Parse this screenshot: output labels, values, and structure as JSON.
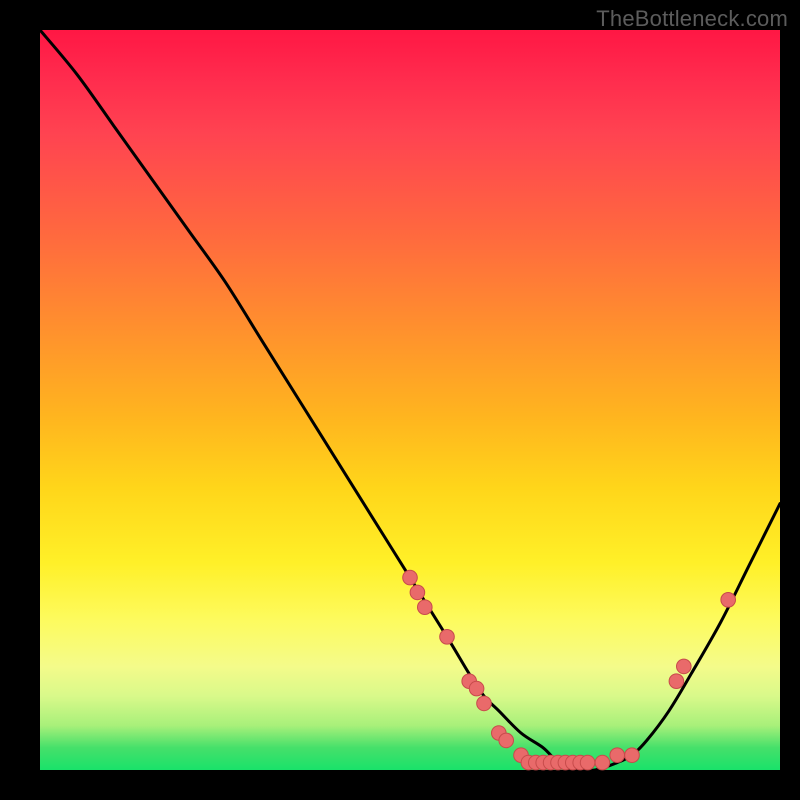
{
  "watermark": "TheBottleneck.com",
  "chart_data": {
    "type": "line",
    "title": "",
    "xlabel": "",
    "ylabel": "",
    "xlim": [
      0,
      100
    ],
    "ylim": [
      0,
      100
    ],
    "grid": false,
    "series": [
      {
        "name": "curve",
        "x": [
          0,
          5,
          10,
          15,
          20,
          25,
          30,
          35,
          40,
          45,
          50,
          55,
          58,
          60,
          62,
          65,
          68,
          70,
          72,
          75,
          78,
          80,
          82,
          85,
          88,
          92,
          96,
          100
        ],
        "y": [
          100,
          94,
          87,
          80,
          73,
          66,
          58,
          50,
          42,
          34,
          26,
          18,
          13,
          10,
          8,
          5,
          3,
          1,
          0,
          0,
          1,
          2,
          4,
          8,
          13,
          20,
          28,
          36
        ]
      }
    ],
    "points": [
      {
        "x": 50,
        "y": 26,
        "r": 1.1
      },
      {
        "x": 51,
        "y": 24,
        "r": 1.1
      },
      {
        "x": 52,
        "y": 22,
        "r": 1.1
      },
      {
        "x": 55,
        "y": 18,
        "r": 1.1
      },
      {
        "x": 58,
        "y": 12,
        "r": 1.1
      },
      {
        "x": 59,
        "y": 11,
        "r": 1.1
      },
      {
        "x": 60,
        "y": 9,
        "r": 1.1
      },
      {
        "x": 62,
        "y": 5,
        "r": 1.1
      },
      {
        "x": 63,
        "y": 4,
        "r": 1.1
      },
      {
        "x": 65,
        "y": 2,
        "r": 1.1
      },
      {
        "x": 66,
        "y": 1,
        "r": 1.1
      },
      {
        "x": 67,
        "y": 1,
        "r": 1.1
      },
      {
        "x": 68,
        "y": 1,
        "r": 1.1
      },
      {
        "x": 69,
        "y": 1,
        "r": 1.1
      },
      {
        "x": 70,
        "y": 1,
        "r": 1.1
      },
      {
        "x": 71,
        "y": 1,
        "r": 1.1
      },
      {
        "x": 72,
        "y": 1,
        "r": 1.1
      },
      {
        "x": 73,
        "y": 1,
        "r": 1.1
      },
      {
        "x": 74,
        "y": 1,
        "r": 1.1
      },
      {
        "x": 76,
        "y": 1,
        "r": 1.1
      },
      {
        "x": 78,
        "y": 2,
        "r": 1.1
      },
      {
        "x": 80,
        "y": 2,
        "r": 1.1
      },
      {
        "x": 86,
        "y": 12,
        "r": 1.1
      },
      {
        "x": 87,
        "y": 14,
        "r": 1.1
      },
      {
        "x": 93,
        "y": 23,
        "r": 1.1
      }
    ],
    "colors": {
      "curve": "#000000",
      "point_fill": "#e96a6a",
      "point_stroke": "#c74b4b"
    }
  }
}
